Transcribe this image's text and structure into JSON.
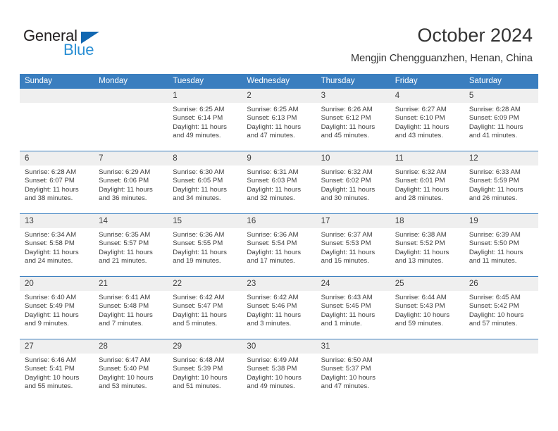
{
  "brand": {
    "name_part1": "General",
    "name_part2": "Blue",
    "triangle_color": "#1167b1",
    "blue_color": "#2a8fd4"
  },
  "header": {
    "title": "October 2024",
    "subtitle": "Mengjin Chengguanzhen, Henan, China"
  },
  "theme": {
    "header_blue": "#3a7ebf",
    "daynum_band": "#efefef",
    "text": "#3d3d3d"
  },
  "calendar": {
    "day_headers": [
      "Sunday",
      "Monday",
      "Tuesday",
      "Wednesday",
      "Thursday",
      "Friday",
      "Saturday"
    ],
    "weeks": [
      [
        {
          "day": "",
          "sunrise": "",
          "sunset": "",
          "daylight1": "",
          "daylight2": ""
        },
        {
          "day": "",
          "sunrise": "",
          "sunset": "",
          "daylight1": "",
          "daylight2": ""
        },
        {
          "day": "1",
          "sunrise": "Sunrise: 6:25 AM",
          "sunset": "Sunset: 6:14 PM",
          "daylight1": "Daylight: 11 hours",
          "daylight2": "and 49 minutes."
        },
        {
          "day": "2",
          "sunrise": "Sunrise: 6:25 AM",
          "sunset": "Sunset: 6:13 PM",
          "daylight1": "Daylight: 11 hours",
          "daylight2": "and 47 minutes."
        },
        {
          "day": "3",
          "sunrise": "Sunrise: 6:26 AM",
          "sunset": "Sunset: 6:12 PM",
          "daylight1": "Daylight: 11 hours",
          "daylight2": "and 45 minutes."
        },
        {
          "day": "4",
          "sunrise": "Sunrise: 6:27 AM",
          "sunset": "Sunset: 6:10 PM",
          "daylight1": "Daylight: 11 hours",
          "daylight2": "and 43 minutes."
        },
        {
          "day": "5",
          "sunrise": "Sunrise: 6:28 AM",
          "sunset": "Sunset: 6:09 PM",
          "daylight1": "Daylight: 11 hours",
          "daylight2": "and 41 minutes."
        }
      ],
      [
        {
          "day": "6",
          "sunrise": "Sunrise: 6:28 AM",
          "sunset": "Sunset: 6:07 PM",
          "daylight1": "Daylight: 11 hours",
          "daylight2": "and 38 minutes."
        },
        {
          "day": "7",
          "sunrise": "Sunrise: 6:29 AM",
          "sunset": "Sunset: 6:06 PM",
          "daylight1": "Daylight: 11 hours",
          "daylight2": "and 36 minutes."
        },
        {
          "day": "8",
          "sunrise": "Sunrise: 6:30 AM",
          "sunset": "Sunset: 6:05 PM",
          "daylight1": "Daylight: 11 hours",
          "daylight2": "and 34 minutes."
        },
        {
          "day": "9",
          "sunrise": "Sunrise: 6:31 AM",
          "sunset": "Sunset: 6:03 PM",
          "daylight1": "Daylight: 11 hours",
          "daylight2": "and 32 minutes."
        },
        {
          "day": "10",
          "sunrise": "Sunrise: 6:32 AM",
          "sunset": "Sunset: 6:02 PM",
          "daylight1": "Daylight: 11 hours",
          "daylight2": "and 30 minutes."
        },
        {
          "day": "11",
          "sunrise": "Sunrise: 6:32 AM",
          "sunset": "Sunset: 6:01 PM",
          "daylight1": "Daylight: 11 hours",
          "daylight2": "and 28 minutes."
        },
        {
          "day": "12",
          "sunrise": "Sunrise: 6:33 AM",
          "sunset": "Sunset: 5:59 PM",
          "daylight1": "Daylight: 11 hours",
          "daylight2": "and 26 minutes."
        }
      ],
      [
        {
          "day": "13",
          "sunrise": "Sunrise: 6:34 AM",
          "sunset": "Sunset: 5:58 PM",
          "daylight1": "Daylight: 11 hours",
          "daylight2": "and 24 minutes."
        },
        {
          "day": "14",
          "sunrise": "Sunrise: 6:35 AM",
          "sunset": "Sunset: 5:57 PM",
          "daylight1": "Daylight: 11 hours",
          "daylight2": "and 21 minutes."
        },
        {
          "day": "15",
          "sunrise": "Sunrise: 6:36 AM",
          "sunset": "Sunset: 5:55 PM",
          "daylight1": "Daylight: 11 hours",
          "daylight2": "and 19 minutes."
        },
        {
          "day": "16",
          "sunrise": "Sunrise: 6:36 AM",
          "sunset": "Sunset: 5:54 PM",
          "daylight1": "Daylight: 11 hours",
          "daylight2": "and 17 minutes."
        },
        {
          "day": "17",
          "sunrise": "Sunrise: 6:37 AM",
          "sunset": "Sunset: 5:53 PM",
          "daylight1": "Daylight: 11 hours",
          "daylight2": "and 15 minutes."
        },
        {
          "day": "18",
          "sunrise": "Sunrise: 6:38 AM",
          "sunset": "Sunset: 5:52 PM",
          "daylight1": "Daylight: 11 hours",
          "daylight2": "and 13 minutes."
        },
        {
          "day": "19",
          "sunrise": "Sunrise: 6:39 AM",
          "sunset": "Sunset: 5:50 PM",
          "daylight1": "Daylight: 11 hours",
          "daylight2": "and 11 minutes."
        }
      ],
      [
        {
          "day": "20",
          "sunrise": "Sunrise: 6:40 AM",
          "sunset": "Sunset: 5:49 PM",
          "daylight1": "Daylight: 11 hours",
          "daylight2": "and 9 minutes."
        },
        {
          "day": "21",
          "sunrise": "Sunrise: 6:41 AM",
          "sunset": "Sunset: 5:48 PM",
          "daylight1": "Daylight: 11 hours",
          "daylight2": "and 7 minutes."
        },
        {
          "day": "22",
          "sunrise": "Sunrise: 6:42 AM",
          "sunset": "Sunset: 5:47 PM",
          "daylight1": "Daylight: 11 hours",
          "daylight2": "and 5 minutes."
        },
        {
          "day": "23",
          "sunrise": "Sunrise: 6:42 AM",
          "sunset": "Sunset: 5:46 PM",
          "daylight1": "Daylight: 11 hours",
          "daylight2": "and 3 minutes."
        },
        {
          "day": "24",
          "sunrise": "Sunrise: 6:43 AM",
          "sunset": "Sunset: 5:45 PM",
          "daylight1": "Daylight: 11 hours",
          "daylight2": "and 1 minute."
        },
        {
          "day": "25",
          "sunrise": "Sunrise: 6:44 AM",
          "sunset": "Sunset: 5:43 PM",
          "daylight1": "Daylight: 10 hours",
          "daylight2": "and 59 minutes."
        },
        {
          "day": "26",
          "sunrise": "Sunrise: 6:45 AM",
          "sunset": "Sunset: 5:42 PM",
          "daylight1": "Daylight: 10 hours",
          "daylight2": "and 57 minutes."
        }
      ],
      [
        {
          "day": "27",
          "sunrise": "Sunrise: 6:46 AM",
          "sunset": "Sunset: 5:41 PM",
          "daylight1": "Daylight: 10 hours",
          "daylight2": "and 55 minutes."
        },
        {
          "day": "28",
          "sunrise": "Sunrise: 6:47 AM",
          "sunset": "Sunset: 5:40 PM",
          "daylight1": "Daylight: 10 hours",
          "daylight2": "and 53 minutes."
        },
        {
          "day": "29",
          "sunrise": "Sunrise: 6:48 AM",
          "sunset": "Sunset: 5:39 PM",
          "daylight1": "Daylight: 10 hours",
          "daylight2": "and 51 minutes."
        },
        {
          "day": "30",
          "sunrise": "Sunrise: 6:49 AM",
          "sunset": "Sunset: 5:38 PM",
          "daylight1": "Daylight: 10 hours",
          "daylight2": "and 49 minutes."
        },
        {
          "day": "31",
          "sunrise": "Sunrise: 6:50 AM",
          "sunset": "Sunset: 5:37 PM",
          "daylight1": "Daylight: 10 hours",
          "daylight2": "and 47 minutes."
        },
        {
          "day": "",
          "sunrise": "",
          "sunset": "",
          "daylight1": "",
          "daylight2": ""
        },
        {
          "day": "",
          "sunrise": "",
          "sunset": "",
          "daylight1": "",
          "daylight2": ""
        }
      ]
    ]
  }
}
